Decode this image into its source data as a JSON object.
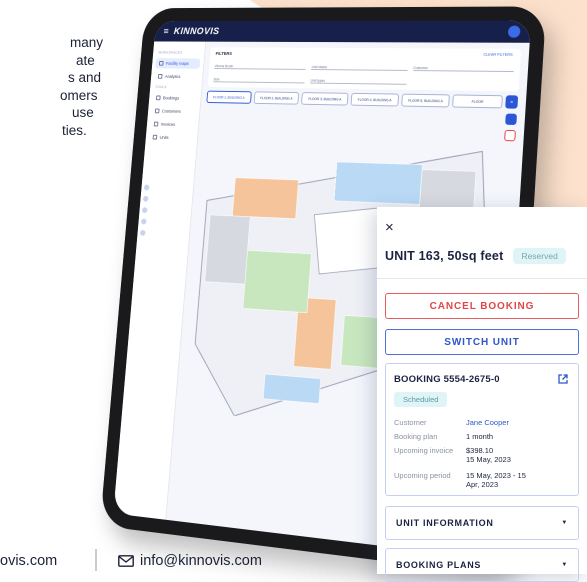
{
  "intro": {
    "lines": [
      "many",
      "ate",
      "s and",
      "omers",
      " use",
      "ties."
    ]
  },
  "tablet": {
    "brand": "KINNOVIS",
    "sidebar": {
      "group1": "WORKSPACES",
      "items": [
        "Facility maps",
        "Analytics"
      ],
      "group2": "TOOLS",
      "items2": [
        "Bookings",
        "Customers",
        "Invoices",
        "Units"
      ]
    },
    "filters": {
      "title": "FILTERS",
      "clear": "CLEAR FILTERS",
      "location_label": "Location",
      "location_value": "Vienna Booth",
      "unit_status": "Unit status",
      "customer": "Customer",
      "size": "Size",
      "unit_types": "Unit types"
    },
    "floor_tabs": [
      "FLOOR 1, BUILDING A",
      "FLOOR 2, BUILDING A",
      "FLOOR 3, BUILDING A",
      "FLOOR 4, BUILDING A",
      "FLOOR 5, BUILDING A",
      "FLOOR"
    ],
    "floor_nav": "»"
  },
  "panel": {
    "close": "×",
    "unit_title": "UNIT 163, 50sq feet",
    "unit_status": "Reserved",
    "cancel_label": "CANCEL BOOKING",
    "switch_label": "SWITCH UNIT",
    "booking": {
      "title": "BOOKING 5554-2675-0",
      "status": "Scheduled",
      "customer_label": "Customer",
      "customer_value": "Jane Cooper",
      "plan_label": "Booking plan",
      "plan_value": "1 month",
      "invoice_label": "Upcoming invoice",
      "invoice_amount": "$398.10",
      "invoice_date": "15 May, 2023",
      "period_label": "Upcoming period",
      "period_value_1": "15 May, 2023 - 15",
      "period_value_2": "Apr, 2023"
    },
    "unit_info_label": "UNIT INFORMATION",
    "booking_plans_label": "BOOKING PLANS"
  },
  "footer": {
    "website": "ovis.com",
    "email": "info@kinnovis.com"
  },
  "colors": {
    "accent_blue": "#2b56d6",
    "cancel_red": "#e04747",
    "badge_teal_bg": "#dff4f6",
    "peach": "#fce1cc",
    "navy": "#16204a"
  }
}
